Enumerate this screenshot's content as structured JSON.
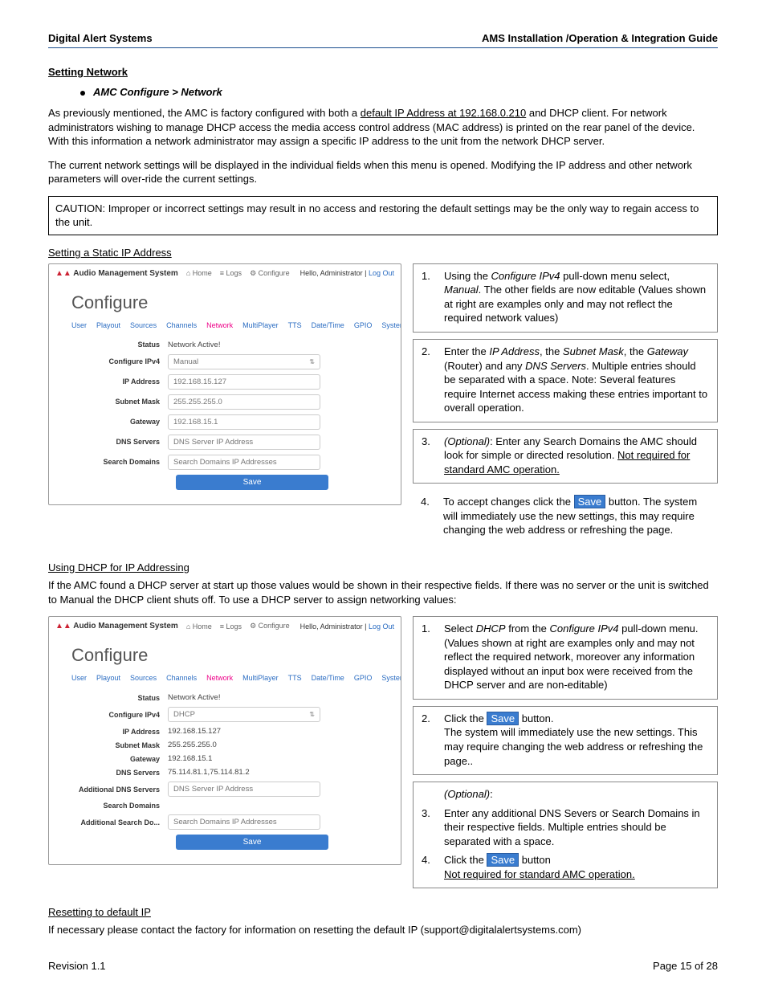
{
  "header": {
    "left": "Digital Alert Systems",
    "right": "AMS Installation /Operation & Integration Guide"
  },
  "s1": {
    "title": "Setting Network",
    "bullet": "AMC Configure > Network",
    "p1a": "As previously mentioned, the AMC is factory configured with both a ",
    "p1u": "default IP Address at 192.168.0.210",
    "p1b": " and DHCP client. For network administrators wishing to manage DHCP access the media access control address (MAC address) is printed on the rear panel of the device. With this information a network administrator may assign a specific IP address to the unit from the network DHCP server.",
    "p2": "The current network settings will be displayed in the individual fields when this menu is opened. Modifying the IP address and other network parameters will over-ride the current settings.",
    "caution": "CAUTION:  Improper or incorrect settings may result in no access and restoring the default settings may be the only way to regain access to the unit."
  },
  "static": {
    "title": "Setting a Static IP Address",
    "shot": {
      "sys": "Audio Management System",
      "home": "Home",
      "logs": "Logs",
      "conf": "Configure",
      "hello": "Hello, Administrator | ",
      "logout": "Log Out",
      "tabs": [
        "User",
        "Playout",
        "Sources",
        "Channels",
        "Network",
        "MultiPlayer",
        "TTS",
        "Date/Time",
        "GPIO",
        "System"
      ],
      "activeTab": 4,
      "fields": {
        "status_l": "Status",
        "status_v": "Network Active!",
        "cfg_l": "Configure IPv4",
        "cfg_v": "Manual",
        "ip_l": "IP Address",
        "ip_v": "192.168.15.127",
        "sm_l": "Subnet Mask",
        "sm_v": "255.255.255.0",
        "gw_l": "Gateway",
        "gw_v": "192.168.15.1",
        "dns_l": "DNS Servers",
        "dns_v": "DNS Server IP Address",
        "sd_l": "Search Domains",
        "sd_v": "Search Domains IP Addresses",
        "save": "Save"
      }
    },
    "steps": {
      "n1": "1.",
      "t1a": "Using the ",
      "t1i": "Configure IPv4",
      "t1b": " pull-down menu select, ",
      "t1i2": "Manual",
      "t1c": ". The other fields are now editable (Values shown at right are examples only and may not reflect the required network values)",
      "n2": "2.",
      "t2a": "Enter the ",
      "t2i1": "IP Address",
      "t2b": ", the ",
      "t2i2": "Subnet Mask",
      "t2c": ", the ",
      "t2i3": "Gateway",
      "t2d": " (Router) and any ",
      "t2i4": "DNS Servers",
      "t2e": ". Multiple entries should be separated with a space. Note: Several features require Internet access making these entries important to overall operation.",
      "n3": "3.",
      "t3a": "(Optional)",
      "t3b": ": Enter any Search Domains the AMC should look for simple or directed resolution. ",
      "t3u": "Not required for standard AMC operation.",
      "n4": "4.",
      "t4a": "To accept changes click the ",
      "t4s": "Save",
      "t4b": " button. The system will immediately use the new settings, this may require changing the web address or refreshing the page."
    }
  },
  "dhcp": {
    "title": "Using DHCP for IP Addressing",
    "p1": "If the AMC found a DHCP server at start up those values would be shown in their respective fields. If there was no server or the unit is switched to Manual the DHCP client shuts off. To use a DHCP server to assign networking values:",
    "shot": {
      "fields": {
        "status_l": "Status",
        "status_v": "Network Active!",
        "cfg_l": "Configure IPv4",
        "cfg_v": "DHCP",
        "ip_l": "IP Address",
        "ip_v": "192.168.15.127",
        "sm_l": "Subnet Mask",
        "sm_v": "255.255.255.0",
        "gw_l": "Gateway",
        "gw_v": "192.168.15.1",
        "dns_l": "DNS Servers",
        "dns_v": "75.114.81.1,75.114.81.2",
        "adns_l": "Additional DNS Servers",
        "adns_v": "DNS Server IP Address",
        "sd_l": "Search Domains",
        "sd_v": "",
        "asd_l": "Additional Search Do...",
        "asd_v": "Search Domains IP Addresses",
        "save": "Save"
      }
    },
    "steps": {
      "n1": "1.",
      "t1a": "Select ",
      "t1i1": "DHCP",
      "t1b": " from the ",
      "t1i2": "Configure IPv4",
      "t1c": " pull-down menu.",
      "t1d": "(Values shown at right are examples only and may not reflect the required network, moreover any information displayed without an input box were received from the DHCP server and are non-editable)",
      "n2": "2.",
      "t2a": "Click the ",
      "t2s": "Save",
      "t2b": " button.",
      "t2c": "The system will immediately use the new settings. This may require changing the web address or refreshing the page..",
      "t3o": "(Optional)",
      "t3op": ":",
      "n3": "3.",
      "t3a": "Enter any additional DNS Severs or Search Domains in their respective fields. Multiple entries should be separated with a space.",
      "n4": "4.",
      "t4a": " Click the ",
      "t4s": "Save",
      "t4b": " button",
      "t4u": "Not required for standard AMC operation."
    }
  },
  "reset": {
    "title": "Resetting to default IP",
    "p": "If necessary please contact the factory for information on resetting the default IP (support@digitalalertsystems.com)"
  },
  "footer": {
    "left": "Revision 1.1",
    "right": "Page 15 of 28"
  }
}
